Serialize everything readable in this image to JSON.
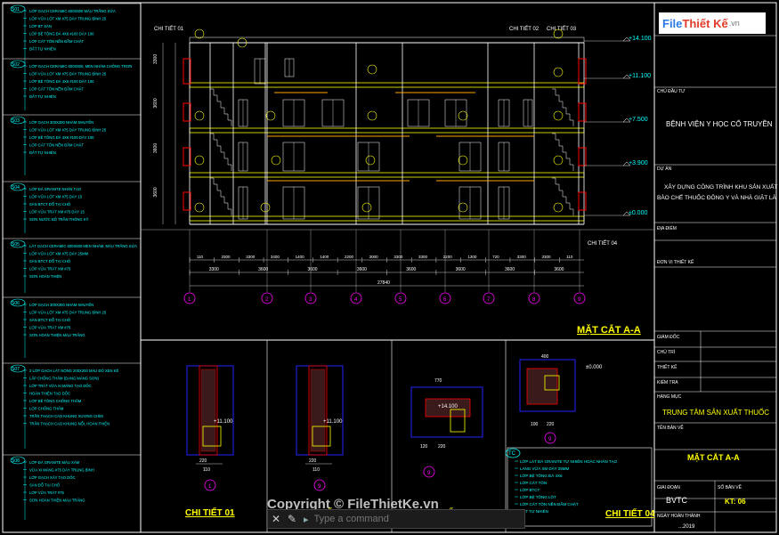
{
  "logo": {
    "part1": "File",
    "part2": "Thiết Kế",
    "part3": ".vn"
  },
  "copyright": "Copyright © FileThietKe.vn",
  "command_bar": {
    "placeholder": "Type a command"
  },
  "notes": [
    {
      "code": "S01",
      "lines": [
        "LỚP GẠCH CERAMIC 600X600 MÀU TRẮNG SỮA",
        "LỚP VỮA LÓT XM #75 DÀY TRUNG BÌNH 25",
        "LỚP BT SÀN",
        "LỚP BÊ TÔNG ĐÁ 4X6 #100 DÀY 100",
        "LỚP CÁT TÔN NỀN ĐẦM CHẶT",
        "ĐẤT TỰ NHIÊN"
      ]
    },
    {
      "code": "S02",
      "lines": [
        "LỚP GẠCH CERAMIC 600X600, MEN NHÁM CHỐNG TRƠN",
        "LỚP VỮA LÓT XM #75 DÀY TRUNG BÌNH 25",
        "LỚP BÊ TÔNG ĐÁ 4X6 #100 DÀY 100",
        "LỚP CÁT TÔN NỀN ĐẦM CHẶT",
        "ĐẤT TỰ NHIÊN"
      ]
    },
    {
      "code": "S03",
      "lines": [
        "LỚP GẠCH 300X300 NHÁM NHUYỄN",
        "LỚP VỮA LÓT XM #75 DÀY TRUNG BÌNH 25",
        "LỚP BÊ TÔNG ĐÁ 4X6 #100 DÀY 100",
        "LỚP CÁT TÔN NỀN ĐẦM CHẶT",
        "ĐẤT TỰ NHIÊN"
      ]
    },
    {
      "code": "S04",
      "lines": [
        "LỚP ĐÁ GRANITE NHÂN TẠO",
        "LỚP VỮA LÓT XM #75 DÀY 15",
        "SÀN BTCT ĐỔ TẠI CHỖ",
        "LỚP VỮA TRÁT XM #75 DÀY 15",
        "SƠN NƯỚC BỘ TRẦN THÔNG KỸ"
      ]
    },
    {
      "code": "S05",
      "lines": [
        "LÁT GẠCH CERAMIC 600X600 MEN NHÁM, MÀU TRẮNG SỮA",
        "LỚP VỮA LÓT XM #75 DÀY 25MM",
        "SÀN BTCT ĐỔ TẠI CHỖ",
        "LỚP VỮA TRÁT XM #75",
        "SƠN HOÀN THIỆN"
      ]
    },
    {
      "code": "S06",
      "lines": [
        "LỚP GẠCH 300X300 NHÁM NHUYỄN",
        "LỚP VỮA LÓT XM #75 DÀY TRUNG BÌNH 25",
        "SÀN BTCT ĐỔ TẠI CHỖ",
        "LỚP VỮA TRÁT XM #75",
        "SƠN HOÀN THIỆN MÀU TRẮNG"
      ]
    },
    {
      "code": "S07",
      "lines": [
        "2 LỚP GẠCH LÁT NÓNG 200X200 MÀU ĐỎ XEN KẼ",
        "LẮP CHỐNG THẤM (DẠNG MÀNG SƠN)",
        "LỚP TRÁT VỮA XI MĂNG TẠO DỐC",
        "HOÀN THIỆN TẠO DỐC",
        "LỚP BÊ TÔNG CHỐNG THẤM",
        "LỚP CHỐNG THẤM",
        "TRẦN THẠCH CAO KHUNG XƯƠNG CHÌM",
        "TRẦN THẠCH CAO KHUNG NỔI, HOÀN THIỆN"
      ]
    },
    {
      "code": "S08",
      "lines": [
        "LỚP ĐÁ GRANITE MÀU XÁM",
        "VỮA XI MĂNG #75 DÀY TRUNG BÌNH",
        "LỚP GẠCH XÂY TẠO DỐC",
        "SÀN ĐỔ TẠI CHỖ",
        "LỚP VỮA TRÁT #75",
        "SƠN HOÀN THIỆN MÀU TRẮNG"
      ]
    }
  ],
  "elevations": [
    "+14.100",
    "+11.100",
    "+7.500",
    "+3.900",
    "±0.000"
  ],
  "section_labels": [
    "CHI TIẾT 01",
    "CHI TIẾT 02",
    "CHI TIẾT 03",
    "CHI TIẾT 04"
  ],
  "floor_dims": [
    "3300",
    "3600",
    "3600",
    "3600"
  ],
  "dim_top": [
    "110",
    "3300",
    "3300",
    "3400",
    "1400",
    "1400",
    "2200",
    "3000",
    "3300",
    "3300",
    "2200",
    "1300",
    "720",
    "3300",
    "3300",
    "110"
  ],
  "dim_mid": [
    "3300",
    "3600",
    "3600",
    "3600",
    "3600",
    "3600",
    "3600",
    "3600"
  ],
  "dim_total": "27840",
  "grid_labels": [
    "1",
    "2",
    "3",
    "4",
    "5",
    "6",
    "7",
    "8",
    "9"
  ],
  "section_title": "MẶT CẮT A-A",
  "detail_titles": [
    "CHI TIẾT 01",
    "CHI TIẾT 02",
    "CHI TIẾT 03",
    "CHI TIẾT 04"
  ],
  "detail_levels": [
    "+11.100",
    "+11.100",
    "+14.100",
    "±0.000"
  ],
  "detail_axes": [
    "1",
    "9",
    "9",
    "9"
  ],
  "detail_dims": {
    "d1": [
      "220",
      "110"
    ],
    "d2": [
      "220",
      "110"
    ],
    "d3": [
      "770",
      "120",
      "220"
    ],
    "d4": [
      "400",
      "100",
      "220"
    ]
  },
  "tc_box": {
    "code": "TC",
    "lines": [
      "LỚP LÁT ĐÁ GRANITE TỰ NHIÊN HOẶC NHÂN TẠO",
      "LÁNG VỮA XM DÀY 25MM",
      "LỚP BÊ TÔNG ĐÁ 4X6",
      "LỚP CÁT TÔN",
      "LỚP BTCT",
      "LỚP BÊ TÔNG LÓT",
      "LỚP CÁT TÔN NỀN ĐẦM CHẶT",
      "ĐẤT TỰ NHIÊN"
    ]
  },
  "title_block": {
    "owner_label": "CHỦ ĐẦU TƯ",
    "owner": "BỆNH VIỆN Y HỌC CỔ TRUYỀN",
    "project_label": "DỰ ÁN",
    "project_line1": "XÂY DỰNG CÔNG TRÌNH KHU SẢN XUẤT",
    "project_line2": "BÀO CHẾ THUỐC ĐÔNG Y VÀ NHÀ GIẶT LÀ",
    "location_label": "ĐỊA ĐIỂM",
    "designer_label": "ĐƠN VỊ THIẾT KẾ",
    "director_label": "GIÁM ĐỐC",
    "chief_label": "CHỦ TRÌ",
    "designer2_label": "THIẾT KẾ",
    "checker_label": "KIỂM TRA",
    "item_label": "HẠNG MỤC",
    "item": "TRUNG TÂM SẢN XUẤT THUỐC",
    "drawing_name_label": "TÊN BẢN VẼ",
    "drawing_name": "MẶT CẮT A-A",
    "phase_label": "GIAI ĐOẠN",
    "phase": "BVTC",
    "sheet_label": "SỐ BẢN VẼ",
    "sheet": "KT: 06",
    "date_label": "NGÀY HOÀN THÀNH",
    "date": "...2019"
  },
  "colors": {
    "bg": "#000000",
    "line": "#ffffff",
    "cyan": "#00ffff",
    "yellow": "#ffff00",
    "red": "#ff0000",
    "blue": "#2222ff",
    "magenta": "#ff00ff",
    "orange": "#ffa500"
  }
}
